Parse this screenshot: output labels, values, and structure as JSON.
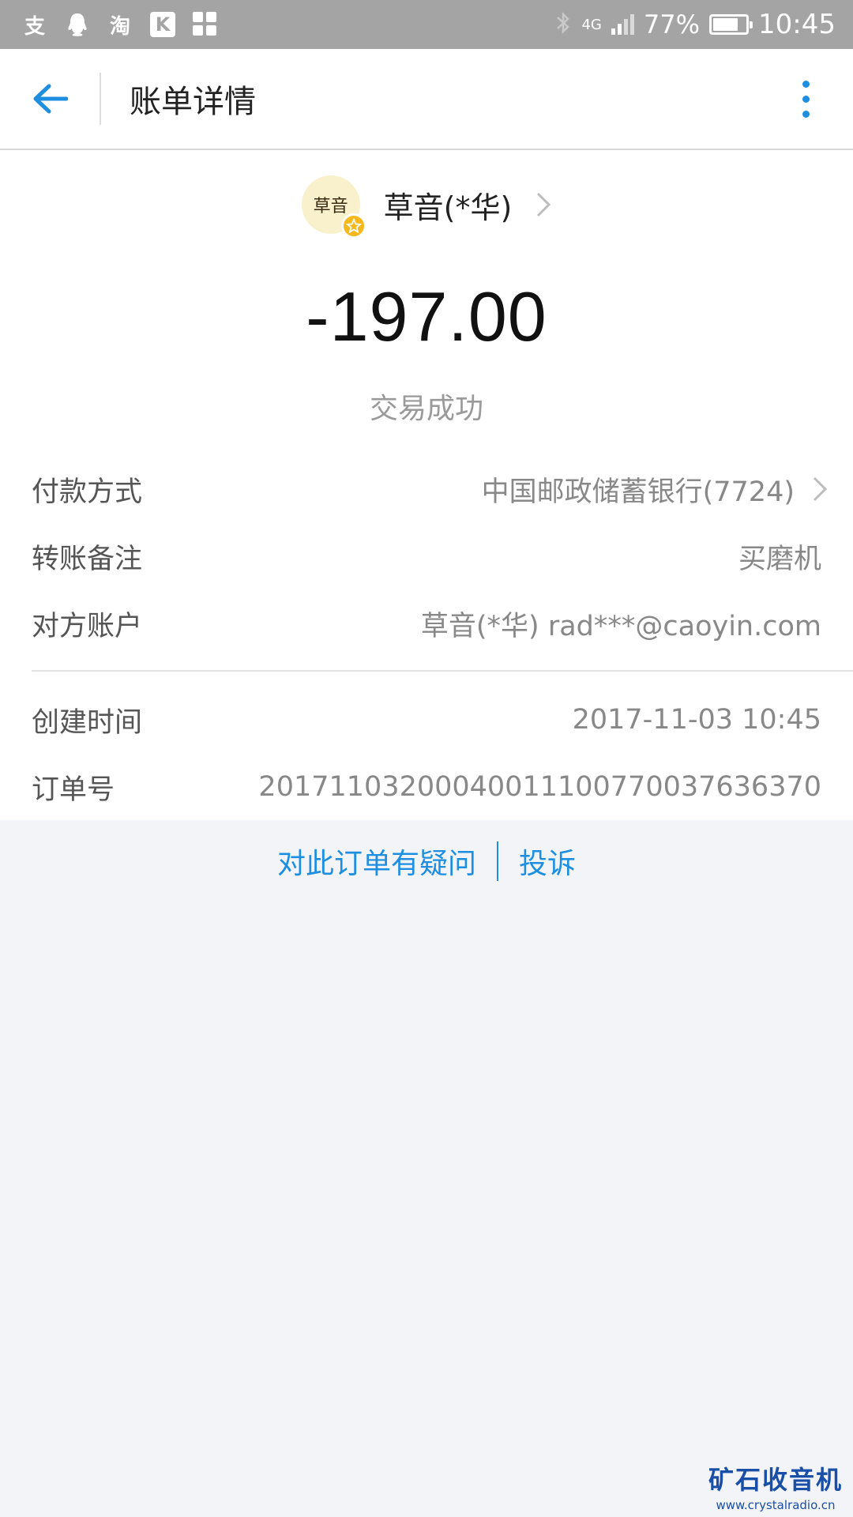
{
  "status_bar": {
    "icons": [
      "alipay-icon",
      "qq-icon",
      "taobao-icon",
      "k-app-icon",
      "grid-app-icon"
    ],
    "alipay_glyph": "支",
    "taobao_glyph": "淘",
    "k_glyph": "K",
    "network": "4G",
    "battery_percent": "77%",
    "battery_level": 0.77,
    "time": "10:45"
  },
  "header": {
    "title": "账单详情"
  },
  "merchant": {
    "name": "草音(*华)",
    "avatar_text": "草音"
  },
  "amount": "-197.00",
  "status": "交易成功",
  "details": [
    {
      "label": "付款方式",
      "value": "中国邮政储蓄银行(7724)"
    },
    {
      "label": "转账备注",
      "value": "买磨机"
    },
    {
      "label": "对方账户",
      "value": "草音(*华) rad***@caoyin.com"
    }
  ],
  "meta": [
    {
      "label": "创建时间",
      "value": "2017-11-03 10:45"
    },
    {
      "label": "订单号",
      "value": "20171103200040011100770037636370"
    }
  ],
  "footer": {
    "question_link": "对此订单有疑问",
    "complain_link": "投诉"
  },
  "watermark": {
    "title": "矿石收音机",
    "url": "www.crystalradio.cn"
  },
  "colors": {
    "accent": "#1e8fe0",
    "status_bar": "#a4a4a4",
    "background": "#f3f4f8"
  }
}
